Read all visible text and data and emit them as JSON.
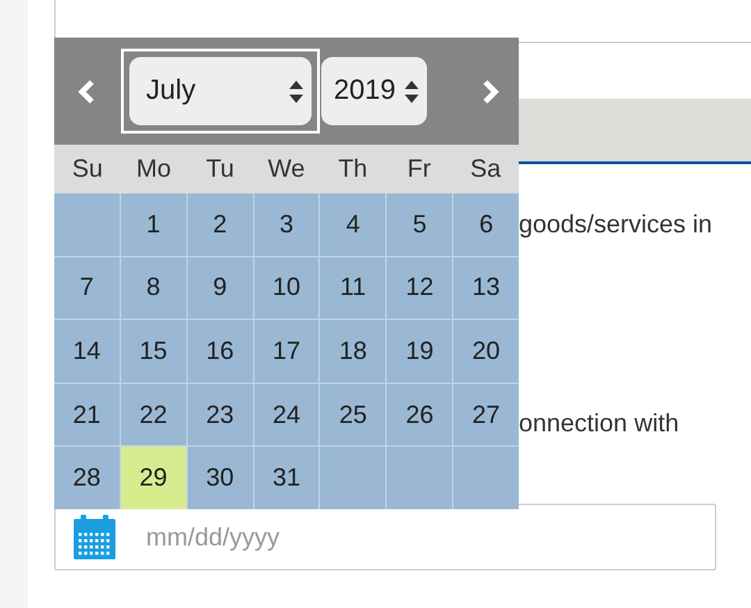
{
  "calendar": {
    "month": "July",
    "month_focused": true,
    "year": "2019",
    "weekdays": [
      "Su",
      "Mo",
      "Tu",
      "We",
      "Th",
      "Fr",
      "Sa"
    ],
    "weeks": [
      [
        {
          "kind": "blank"
        },
        {
          "kind": "day",
          "day": "1",
          "selected": false
        },
        {
          "kind": "day",
          "day": "2",
          "selected": false
        },
        {
          "kind": "day",
          "day": "3",
          "selected": false
        },
        {
          "kind": "day",
          "day": "4",
          "selected": false
        },
        {
          "kind": "day",
          "day": "5",
          "selected": false
        },
        {
          "kind": "day",
          "day": "6",
          "selected": false
        }
      ],
      [
        {
          "kind": "day",
          "day": "7",
          "selected": false
        },
        {
          "kind": "day",
          "day": "8",
          "selected": false
        },
        {
          "kind": "day",
          "day": "9",
          "selected": false
        },
        {
          "kind": "day",
          "day": "10",
          "selected": false
        },
        {
          "kind": "day",
          "day": "11",
          "selected": false
        },
        {
          "kind": "day",
          "day": "12",
          "selected": false
        },
        {
          "kind": "day",
          "day": "13",
          "selected": false
        }
      ],
      [
        {
          "kind": "day",
          "day": "14",
          "selected": false
        },
        {
          "kind": "day",
          "day": "15",
          "selected": false
        },
        {
          "kind": "day",
          "day": "16",
          "selected": false
        },
        {
          "kind": "day",
          "day": "17",
          "selected": false
        },
        {
          "kind": "day",
          "day": "18",
          "selected": false
        },
        {
          "kind": "day",
          "day": "19",
          "selected": false
        },
        {
          "kind": "day",
          "day": "20",
          "selected": false
        }
      ],
      [
        {
          "kind": "day",
          "day": "21",
          "selected": false
        },
        {
          "kind": "day",
          "day": "22",
          "selected": false
        },
        {
          "kind": "day",
          "day": "23",
          "selected": false
        },
        {
          "kind": "day",
          "day": "24",
          "selected": false
        },
        {
          "kind": "day",
          "day": "25",
          "selected": false
        },
        {
          "kind": "day",
          "day": "26",
          "selected": false
        },
        {
          "kind": "day",
          "day": "27",
          "selected": false
        }
      ],
      [
        {
          "kind": "day",
          "day": "28",
          "selected": false
        },
        {
          "kind": "day",
          "day": "29",
          "selected": true
        },
        {
          "kind": "day",
          "day": "30",
          "selected": false
        },
        {
          "kind": "day",
          "day": "31",
          "selected": false
        },
        {
          "kind": "blank"
        },
        {
          "kind": "blank"
        },
        {
          "kind": "blank"
        }
      ]
    ]
  },
  "texts": [
    "goods/services in",
    "onnection with"
  ],
  "date_field": {
    "placeholder": "mm/dd/yyyy"
  }
}
